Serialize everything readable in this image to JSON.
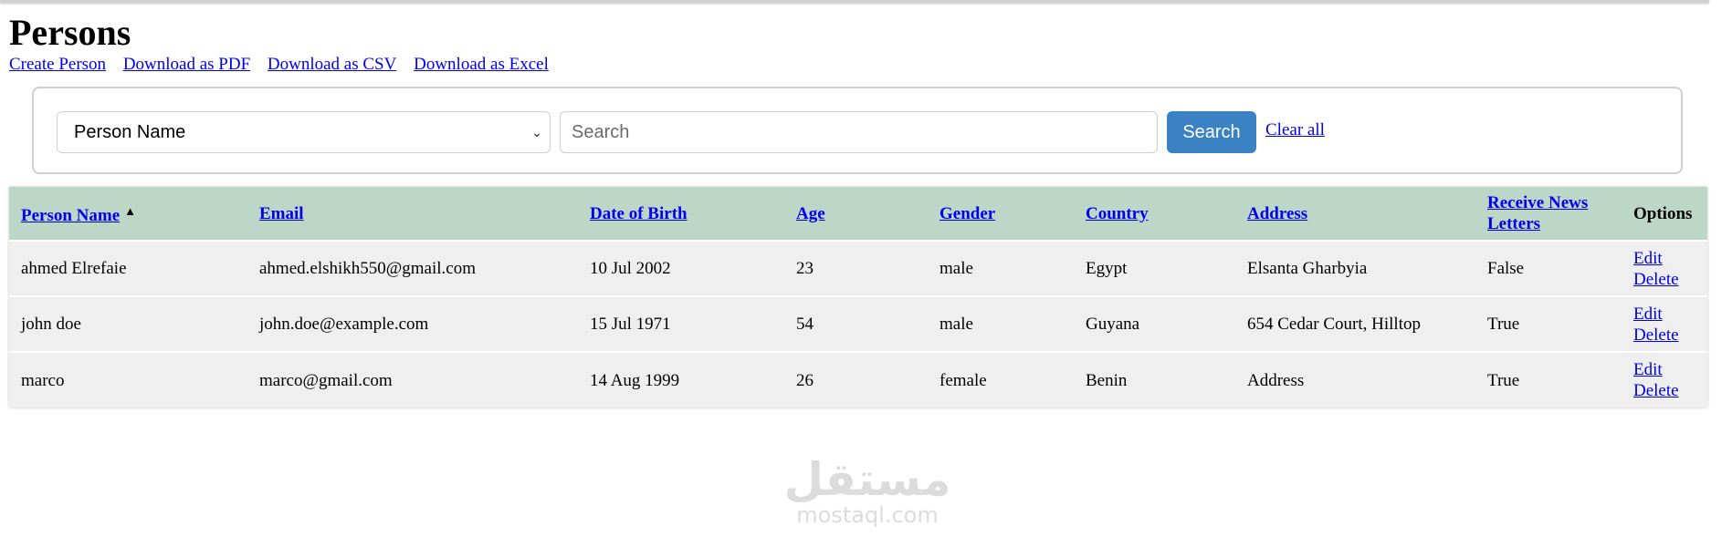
{
  "page": {
    "title": "Persons"
  },
  "actions": {
    "create": "Create Person",
    "pdf": "Download as PDF",
    "csv": "Download as CSV",
    "excel": "Download as Excel"
  },
  "filter": {
    "field_selected": "Person Name",
    "search_placeholder": "Search",
    "search_button": "Search",
    "clear_all": "Clear all"
  },
  "table": {
    "headers": {
      "name": "Person Name",
      "email": "Email",
      "dob": "Date of Birth",
      "age": "Age",
      "gender": "Gender",
      "country": "Country",
      "address": "Address",
      "news": "Receive News Letters",
      "options": "Options"
    },
    "sort_icon": "caret-up-icon",
    "rows": [
      {
        "name": "ahmed Elrefaie",
        "email": "ahmed.elshikh550@gmail.com",
        "dob": "10 Jul 2002",
        "age": "23",
        "gender": "male",
        "country": "Egypt",
        "address": "Elsanta Gharbyia",
        "news": "False",
        "edit": "Edit",
        "delete": "Delete"
      },
      {
        "name": "john doe",
        "email": "john.doe@example.com",
        "dob": "15 Jul 1971",
        "age": "54",
        "gender": "male",
        "country": "Guyana",
        "address": "654 Cedar Court, Hilltop",
        "news": "True",
        "edit": "Edit",
        "delete": "Delete"
      },
      {
        "name": "marco",
        "email": "marco@gmail.com",
        "dob": "14 Aug 1999",
        "age": "26",
        "gender": "female",
        "country": "Benin",
        "address": "Address",
        "news": "True",
        "edit": "Edit",
        "delete": "Delete"
      }
    ]
  },
  "watermark": {
    "arabic": "مستقل",
    "latin": "mostaql.com"
  }
}
